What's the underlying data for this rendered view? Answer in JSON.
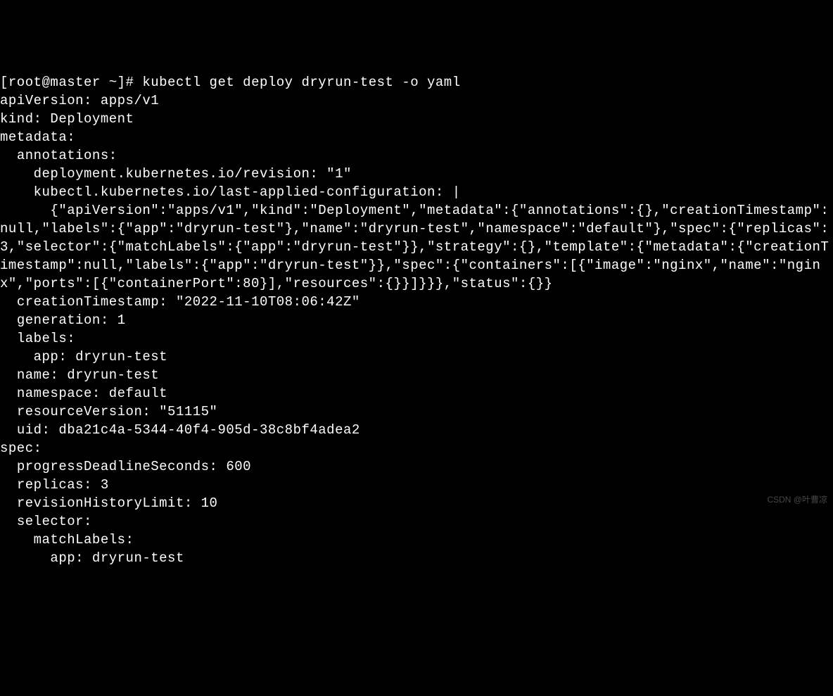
{
  "terminal": {
    "prompt": "[root@master ~]# ",
    "command": "kubectl get deploy dryrun-test -o yaml",
    "output": "apiVersion: apps/v1\nkind: Deployment\nmetadata:\n  annotations:\n    deployment.kubernetes.io/revision: \"1\"\n    kubectl.kubernetes.io/last-applied-configuration: |\n      {\"apiVersion\":\"apps/v1\",\"kind\":\"Deployment\",\"metadata\":{\"annotations\":{},\"creationTimestamp\":null,\"labels\":{\"app\":\"dryrun-test\"},\"name\":\"dryrun-test\",\"namespace\":\"default\"},\"spec\":{\"replicas\":3,\"selector\":{\"matchLabels\":{\"app\":\"dryrun-test\"}},\"strategy\":{},\"template\":{\"metadata\":{\"creationTimestamp\":null,\"labels\":{\"app\":\"dryrun-test\"}},\"spec\":{\"containers\":[{\"image\":\"nginx\",\"name\":\"nginx\",\"ports\":[{\"containerPort\":80}],\"resources\":{}}]}}},\"status\":{}}\n  creationTimestamp: \"2022-11-10T08:06:42Z\"\n  generation: 1\n  labels:\n    app: dryrun-test\n  name: dryrun-test\n  namespace: default\n  resourceVersion: \"51115\"\n  uid: dba21c4a-5344-40f4-905d-38c8bf4adea2\nspec:\n  progressDeadlineSeconds: 600\n  replicas: 3\n  revisionHistoryLimit: 10\n  selector:\n    matchLabels:\n      app: dryrun-test"
  },
  "watermark": "CSDN @叶曹凉"
}
